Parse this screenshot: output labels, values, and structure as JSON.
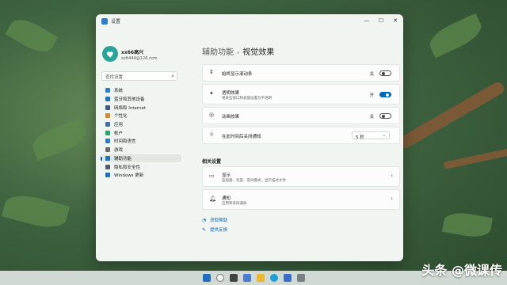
{
  "window": {
    "title": "设置",
    "controls": {
      "minimize": "—",
      "maximize": "☐",
      "close": "✕"
    }
  },
  "user": {
    "name": "xx66高兴",
    "email": "soft444@126.com"
  },
  "search": {
    "placeholder": "查找设置",
    "icon": "search-icon"
  },
  "sidebar": {
    "items": [
      {
        "label": "系统",
        "icon": "monitor-icon",
        "color": "#2b7cd3"
      },
      {
        "label": "蓝牙和其他设备",
        "icon": "bluetooth-icon",
        "color": "#1a73c9"
      },
      {
        "label": "网络和 Internet",
        "icon": "network-icon",
        "color": "#3a5a8c"
      },
      {
        "label": "个性化",
        "icon": "brush-icon",
        "color": "#d98b2b"
      },
      {
        "label": "应用",
        "icon": "apps-icon",
        "color": "#4a6fa5"
      },
      {
        "label": "帐户",
        "icon": "account-icon",
        "color": "#2aa36b"
      },
      {
        "label": "时间和语言",
        "icon": "globe-clock-icon",
        "color": "#2b7cd3"
      },
      {
        "label": "游戏",
        "icon": "gamepad-icon",
        "color": "#6b6b6b"
      },
      {
        "label": "辅助功能",
        "icon": "accessibility-icon",
        "color": "#1f6fc2",
        "active": true
      },
      {
        "label": "隐私和安全性",
        "icon": "shield-icon",
        "color": "#555b66"
      },
      {
        "label": "Windows 更新",
        "icon": "update-icon",
        "color": "#1f6fc2"
      }
    ]
  },
  "breadcrumb": {
    "parent": "辅助功能",
    "separator": "›",
    "current": "视觉效果"
  },
  "settings": [
    {
      "title": "始终显示滚动条",
      "state": "关",
      "on": false
    },
    {
      "title": "透明效果",
      "subtitle": "将某些窗口和表面设置为半透明",
      "state": "开",
      "on": true
    },
    {
      "title": "动画效果",
      "state": "关",
      "on": false
    },
    {
      "title": "在此时间后关闭通知",
      "select_value": "5 秒",
      "select_chevron": "⌄"
    }
  ],
  "related": {
    "heading": "相关设置",
    "items": [
      {
        "title": "显示",
        "subtitle": "监视器、亮度、夜间模式、显示描述文件"
      },
      {
        "title": "通知",
        "subtitle": "应用和系统通知"
      }
    ]
  },
  "links": [
    {
      "label": "获取帮助"
    },
    {
      "label": "提供反馈"
    }
  ],
  "watermark": "头条 @微课传"
}
